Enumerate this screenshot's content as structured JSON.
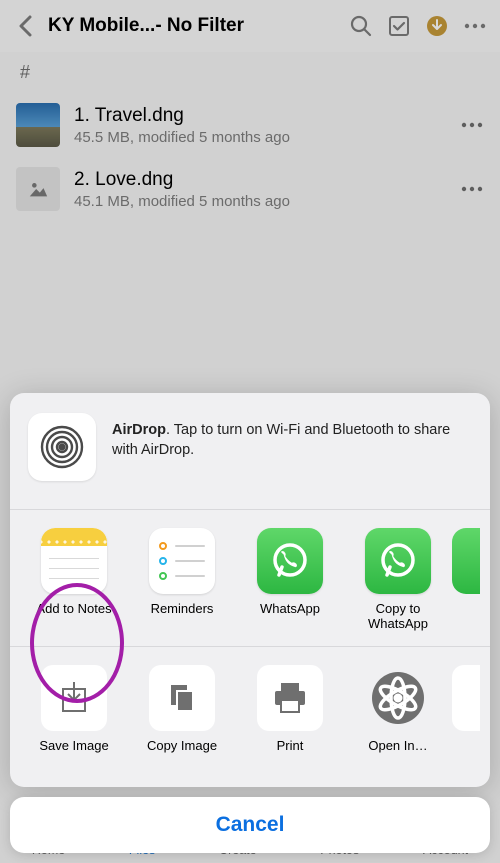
{
  "header": {
    "title": "KY Mobile...- No Filter"
  },
  "hash": "#",
  "files": [
    {
      "name": "1. Travel.dng",
      "sub": "45.5 MB, modified 5 months ago"
    },
    {
      "name": "2. Love.dng",
      "sub": "45.1 MB, modified 5 months ago"
    }
  ],
  "airdrop": {
    "title": "AirDrop",
    "body": ". Tap to turn on Wi-Fi and Bluetooth to share with AirDrop."
  },
  "apps": {
    "notes": "Add to Notes",
    "reminders": "Reminders",
    "whatsapp": "WhatsApp",
    "copy_whatsapp": "Copy to WhatsApp"
  },
  "actions": {
    "save_image": "Save Image",
    "copy_image": "Copy Image",
    "print": "Print",
    "open_in": "Open In…"
  },
  "cancel": "Cancel",
  "tabs": {
    "home": "Home",
    "files": "Files",
    "create": "Create",
    "photos": "Photos",
    "account": "Account"
  }
}
